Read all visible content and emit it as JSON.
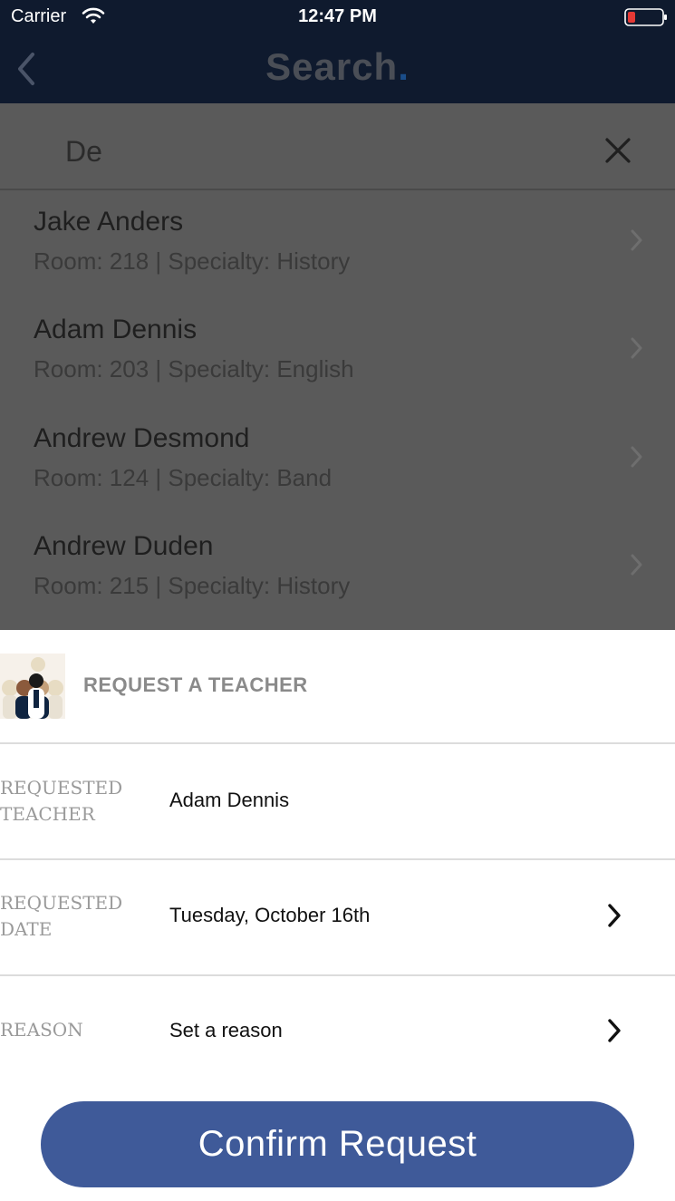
{
  "status_bar": {
    "carrier": "Carrier",
    "time": "12:47 PM"
  },
  "nav": {
    "title": "Search",
    "title_dot": "."
  },
  "search": {
    "value": "De",
    "placeholder": ""
  },
  "results": [
    {
      "name": "Jake Anders",
      "detail": "Room: 218 | Specialty: History"
    },
    {
      "name": "Adam Dennis",
      "detail": "Room: 203 | Specialty: English"
    },
    {
      "name": "Andrew Desmond",
      "detail": "Room: 124 | Specialty: Band"
    },
    {
      "name": "Andrew Duden",
      "detail": "Room: 215 | Specialty: History"
    }
  ],
  "request": {
    "title": "REQUEST A TEACHER",
    "rows": [
      {
        "label_line1": "REQUESTED",
        "label_line2": "TEACHER",
        "value": "Adam Dennis"
      },
      {
        "label_line1": "REQUESTED",
        "label_line2": "DATE",
        "value": "Tuesday, October 16th"
      },
      {
        "label_line1": "REASON",
        "label_line2": "",
        "value": "Set a reason"
      }
    ],
    "confirm_label": "Confirm Request"
  },
  "colors": {
    "nav_background": "#0f1a2e",
    "overlay_gray": "#5a5a5a",
    "accent_button": "#3f5a99",
    "battery_low": "#e53935"
  },
  "icons": [
    "wifi-icon",
    "battery-icon",
    "back-icon",
    "close-icon",
    "chevron-right-icon",
    "teacher-group-icon"
  ]
}
